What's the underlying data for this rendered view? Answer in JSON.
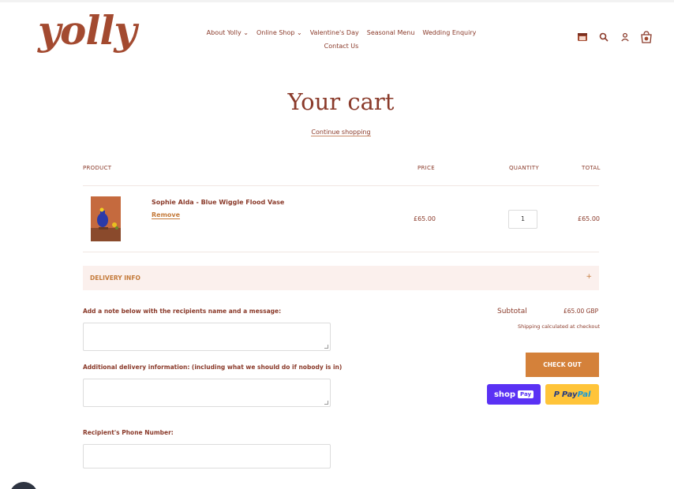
{
  "header": {
    "logo_text": "yolly",
    "nav": [
      "About Yolly ⌄",
      "Online Shop ⌄",
      "Valentine's Day",
      "Seasonal Menu",
      "Wedding Enquiry",
      "Contact Us"
    ],
    "icons": [
      "store-icon",
      "search-icon",
      "account-icon",
      "cart-icon"
    ]
  },
  "cart": {
    "title": "Your cart",
    "continue_label": "Continue shopping",
    "columns": {
      "product": "PRODUCT",
      "price": "PRICE",
      "quantity": "QUANTITY",
      "total": "TOTAL"
    },
    "item": {
      "name": "Sophie Alda - Blue Wiggle Flood Vase",
      "remove_label": "Remove",
      "price": "£65.00",
      "quantity": "1",
      "total": "£65.00"
    }
  },
  "delivery": {
    "label": "DELIVERY INFO",
    "toggle": "+"
  },
  "form": {
    "note_label": "Add a note below with the recipients name and a message:",
    "additional_label": "Additional delivery information: (including what we should do if nobody is in)",
    "phone_label": "Recipient's Phone Number:"
  },
  "summary": {
    "subtotal_label": "Subtotal",
    "subtotal_value": "£65.00 GBP",
    "shipping_note": "Shipping calculated at checkout",
    "checkout_label": "CHECK OUT",
    "shoppay_label": "shop",
    "shoppay_badge": "Pay",
    "paypal_label_1": "Pay",
    "paypal_label_2": "Pal"
  },
  "colors": {
    "brand": "#8a3a2a",
    "accent": "#d4813a",
    "delivery_bg": "#fbf0ed",
    "shoppay": "#5a31f4",
    "paypal": "#ffc439"
  }
}
